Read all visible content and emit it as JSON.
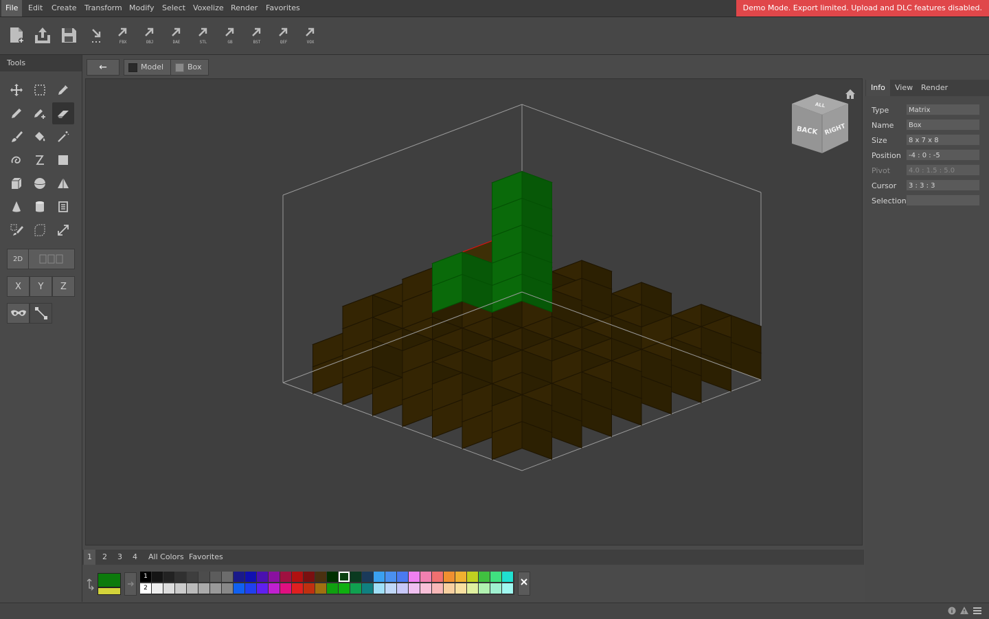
{
  "menu": [
    "File",
    "Edit",
    "Create",
    "Transform",
    "Modify",
    "Select",
    "Voxelize",
    "Render",
    "Favorites"
  ],
  "demo_banner": "Demo Mode. Export limited. Upload and DLC features disabled.",
  "export_formats": [
    "FBX",
    "OBJ",
    "DAE",
    "STL",
    "GB",
    "BST",
    "QEF",
    "VOX"
  ],
  "tools_title": "Tools",
  "view_2d_label": "2D",
  "axes": [
    "X",
    "Y",
    "Z"
  ],
  "breadcrumb": {
    "back": "←",
    "model": "Model",
    "box": "Box"
  },
  "nav_cube": {
    "top": "ALL",
    "left": "BACK",
    "right": "RIGHT"
  },
  "right_tabs": [
    "Info",
    "View",
    "Render"
  ],
  "info": [
    {
      "label": "Type",
      "value": "Matrix"
    },
    {
      "label": "Name",
      "value": "Box"
    },
    {
      "label": "Size",
      "value": "8 x 7 x 8"
    },
    {
      "label": "Position",
      "value": "-4 : 0 : -5"
    },
    {
      "label": "Pivot",
      "value": "4.0 : 1.5 : 5.0"
    },
    {
      "label": "Cursor",
      "value": "3 : 3 : 3"
    },
    {
      "label": "Selection",
      "value": ""
    }
  ],
  "palette_tabs": [
    "1",
    "2",
    "3",
    "4",
    "All Colors",
    "Favorites"
  ],
  "palette_row_labels": [
    "1",
    "2"
  ],
  "colors": {
    "primary": "#0c7a0c",
    "secondary": "#d4d43a",
    "demo": "#e0474a",
    "palette_row1": [
      "#000000",
      "#141414",
      "#222222",
      "#303030",
      "#3e3e3e",
      "#4c4c4c",
      "#5c5c5c",
      "#6c6c6c",
      "#1a1a8a",
      "#1010b0",
      "#4a10b0",
      "#8a10a0",
      "#a01040",
      "#b01010",
      "#7a1010",
      "#4a3010",
      "#003000",
      "#0a4010",
      "#0a3a20",
      "#1a3a5a",
      "#3aa0f0",
      "#4a90f0",
      "#4a7af0",
      "#f080f0",
      "#f080b0",
      "#f07070",
      "#f09030",
      "#f0b030",
      "#c0d020",
      "#40c040",
      "#40e080",
      "#20e0d0"
    ],
    "palette_row2": [
      "#ffffff",
      "#eeeeee",
      "#dddddd",
      "#cccccc",
      "#bbbbbb",
      "#aaaaaa",
      "#999999",
      "#888888",
      "#1060f0",
      "#2040f0",
      "#6020f0",
      "#c020d0",
      "#e01080",
      "#e02020",
      "#c03010",
      "#a07010",
      "#10a010",
      "#10b010",
      "#10a050",
      "#108080",
      "#a0e0f8",
      "#c0d8f8",
      "#c8c8f8",
      "#f0c0f0",
      "#f8c0d8",
      "#f8b8b8",
      "#f8d0a0",
      "#f8e0a0",
      "#e0f0a0",
      "#b0f0b0",
      "#a0f0d0",
      "#a0f8f0"
    ]
  }
}
